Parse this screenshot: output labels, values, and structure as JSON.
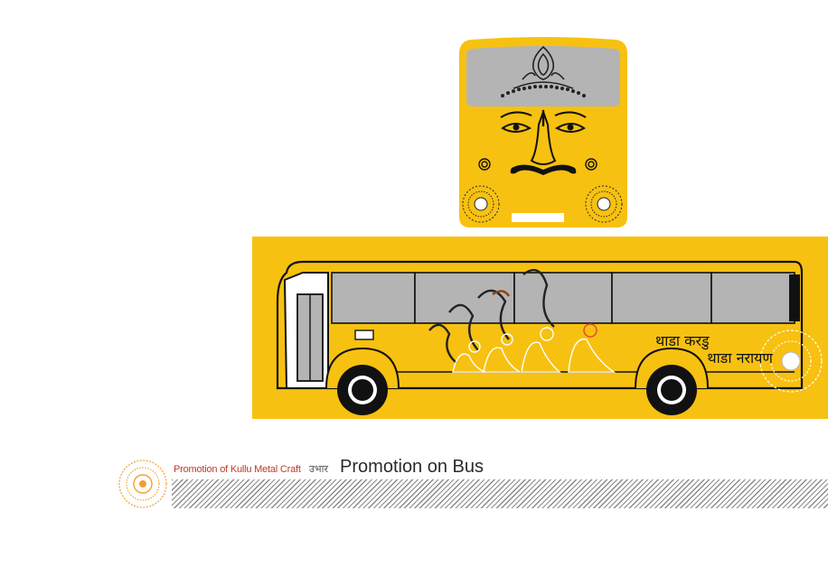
{
  "front": {
    "plate_color": "#ffffff"
  },
  "side": {
    "slogan_line1": "थाडा करडु",
    "slogan_line2": "थाडा नरायण"
  },
  "footer": {
    "small_label": "Promotion of Kullu Metal Craft",
    "hindi_label": "उभार",
    "title": "Promotion on Bus"
  },
  "colors": {
    "bus_yellow": "#f7c111",
    "window_gray": "#b4b4b4",
    "accent_red": "#c0392b",
    "logo_orange": "#f0a030"
  },
  "icons": [
    "sunflower-icon",
    "horn-player-figures",
    "face-artwork"
  ]
}
